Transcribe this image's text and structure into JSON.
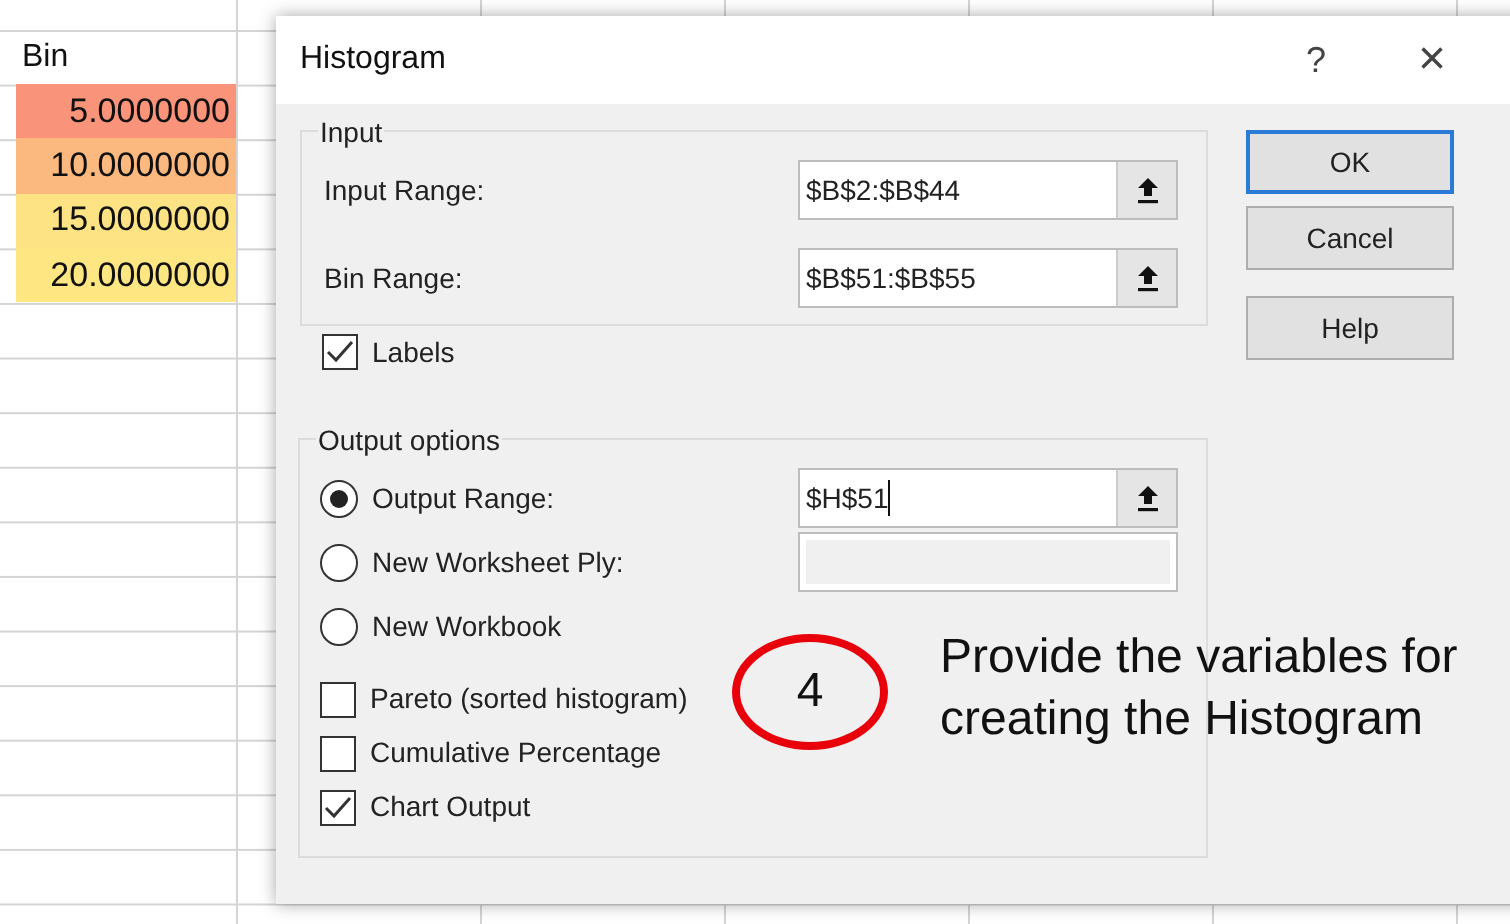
{
  "sheet": {
    "header": "Bin",
    "cells": [
      {
        "value": "5.0000000",
        "color": "#f9937a"
      },
      {
        "value": "10.0000000",
        "color": "#fbb87f"
      },
      {
        "value": "15.0000000",
        "color": "#fde383"
      },
      {
        "value": "20.0000000",
        "color": "#fee783"
      }
    ]
  },
  "dialog": {
    "title": "Histogram",
    "help": "?",
    "close": "×",
    "input": {
      "legend": "Input",
      "fields": [
        {
          "label": "Input Range:",
          "value": "$B$2:$B$44"
        },
        {
          "label": "Bin Range:",
          "value": "$B$51:$B$55"
        }
      ],
      "labels": {
        "label": "Labels",
        "checked": true
      }
    },
    "output": {
      "legend": "Output options",
      "options": [
        {
          "kind": "radio",
          "label": "Output Range:",
          "selected": true,
          "field": {
            "value": "$H$51",
            "focused": true,
            "disabled": false
          }
        },
        {
          "kind": "radio",
          "label": "New Worksheet Ply:",
          "selected": false,
          "field": {
            "disabled": true
          }
        },
        {
          "kind": "radio",
          "label": "New Workbook",
          "selected": false
        },
        {
          "kind": "checkbox",
          "label": "Pareto (sorted histogram)",
          "checked": false
        },
        {
          "kind": "checkbox",
          "label": "Cumulative Percentage",
          "checked": false
        },
        {
          "kind": "checkbox",
          "label": "Chart Output",
          "checked": true
        }
      ]
    },
    "buttons": [
      {
        "label": "OK",
        "default": true
      },
      {
        "label": "Cancel",
        "default": false
      },
      {
        "label": "Help",
        "default": false
      }
    ]
  },
  "annotation": {
    "step": "4",
    "text": "Provide the variables for creating the Histogram"
  }
}
